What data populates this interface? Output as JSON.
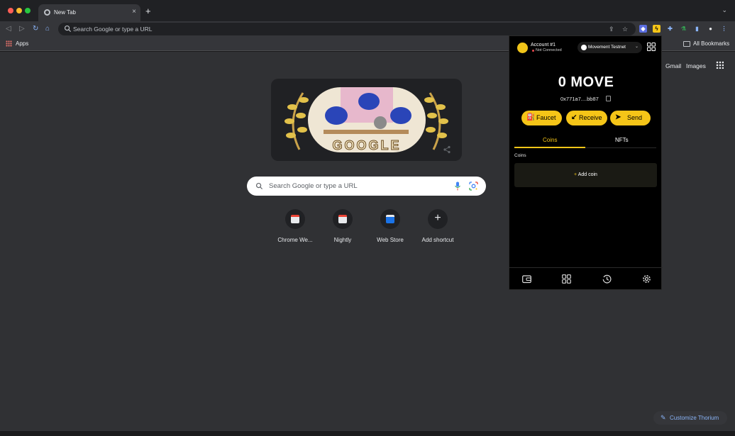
{
  "browser": {
    "tab": {
      "title": "New Tab",
      "close": "×"
    },
    "new_tab": "+",
    "tabstrip_menu": "⌄",
    "nav": {
      "back": "◁",
      "forward": "▷",
      "reload": "↻",
      "home": "⌂"
    },
    "omnibox": {
      "placeholder": "Search Google or type a URL"
    },
    "toolbar_icons": [
      "share-icon",
      "bookmark-star-icon",
      "extension-shield-icon",
      "extension-bolt-icon",
      "extensions-puzzle-icon",
      "extension-flask-icon",
      "side-panel-icon",
      "profile-icon",
      "menu-icon"
    ],
    "bookmarks_bar": {
      "apps": "Apps",
      "all_bookmarks": "All Bookmarks"
    }
  },
  "ntp": {
    "links": {
      "gmail": "Gmail",
      "images": "Images"
    },
    "search": {
      "placeholder": "Search Google or type a URL"
    },
    "logo_text": "GOOGLE",
    "shortcuts": [
      {
        "label": "Chrome We...",
        "icon": "chrome-web-store-icon"
      },
      {
        "label": "Nightly",
        "icon": "nightly-icon"
      },
      {
        "label": "Web Store",
        "icon": "web-store-icon"
      },
      {
        "label": "Add shortcut",
        "icon": "plus-icon"
      }
    ],
    "customize": {
      "icon": "✎",
      "label": "Customize Thorium"
    }
  },
  "wallet": {
    "account": "Account #1",
    "status": "Not Connected",
    "network": "Movement Testnet",
    "balance": "0 MOVE",
    "address": "0x771a7....bb87",
    "buttons": {
      "faucet": "Faucet",
      "receive": "Receive",
      "send": "Send"
    },
    "button_icons": {
      "faucet": "⛽",
      "receive": "↙",
      "send": "➤"
    },
    "tabs": {
      "coins": "Coins",
      "nfts": "NFTs"
    },
    "section": "Coins",
    "add_coin": "Add coin",
    "add_coin_icon": "+",
    "colors": {
      "accent": "#f5c518",
      "background": "#000000",
      "status_dot": "#e5484d"
    }
  }
}
